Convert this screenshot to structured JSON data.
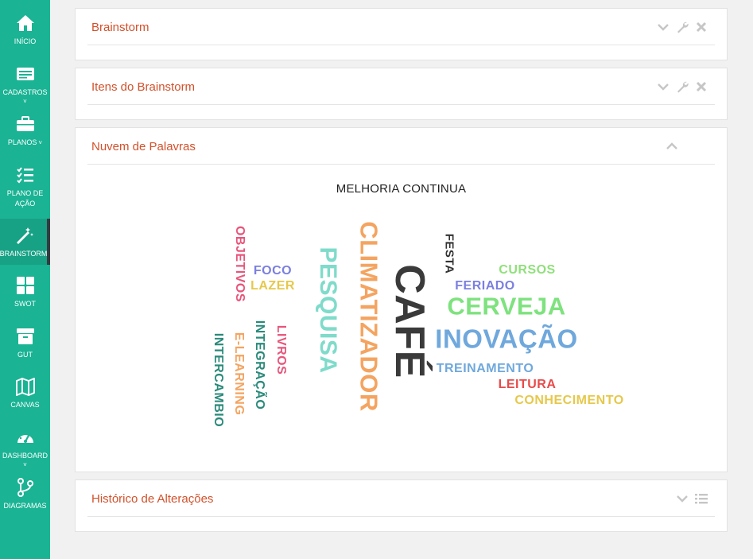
{
  "sidebar": {
    "items": [
      {
        "label": "INÍCIO",
        "icon": "home-icon"
      },
      {
        "label": "CADASTROS",
        "icon": "card-icon"
      },
      {
        "label": "PLANOS",
        "icon": "briefcase-icon"
      },
      {
        "label": "PLANO DE AÇÃO",
        "icon": "checklist-icon"
      },
      {
        "label": "BRAINSTORM",
        "icon": "magic-wand-icon"
      },
      {
        "label": "SWOT",
        "icon": "grid-icon"
      },
      {
        "label": "GUT",
        "icon": "archive-icon"
      },
      {
        "label": "CANVAS",
        "icon": "map-icon"
      },
      {
        "label": "DASHBOARD",
        "icon": "gauge-icon"
      },
      {
        "label": "DIAGRAMAS",
        "icon": "branch-icon"
      }
    ],
    "caret": "˅",
    "active": "BRAINSTORM",
    "color": "#1ab394"
  },
  "panels": {
    "brainstorm": {
      "title": "Brainstorm"
    },
    "itens": {
      "title": "Itens do Brainstorm"
    },
    "nuvem": {
      "title": "Nuvem de Palavras"
    },
    "historico": {
      "title": "Histórico de Alterações"
    }
  },
  "cloud": {
    "title": "MELHORIA CONTINUA",
    "words": [
      {
        "text": "CAFÉ",
        "color": "#3a3a3a",
        "rotated": true
      },
      {
        "text": "CLIMATIZADOR",
        "color": "#f4a460",
        "rotated": true
      },
      {
        "text": "PESQUISA",
        "color": "#7fdbca",
        "rotated": true
      },
      {
        "text": "INOVAÇÃO",
        "color": "#6fa8dc",
        "rotated": false
      },
      {
        "text": "CERVEJA",
        "color": "#7ee27e",
        "rotated": false
      },
      {
        "text": "FERIADO",
        "color": "#7b7fe0",
        "rotated": false
      },
      {
        "text": "CURSOS",
        "color": "#8fe07a",
        "rotated": false
      },
      {
        "text": "FESTA",
        "color": "#333333",
        "rotated": true
      },
      {
        "text": "TREINAMENTO",
        "color": "#6fa8dc",
        "rotated": false
      },
      {
        "text": "LEITURA",
        "color": "#e84a4a",
        "rotated": false
      },
      {
        "text": "CONHECIMENTO",
        "color": "#e6c84a",
        "rotated": false
      },
      {
        "text": "FOCO",
        "color": "#7b7fe0",
        "rotated": false
      },
      {
        "text": "LAZER",
        "color": "#e6c84a",
        "rotated": false
      },
      {
        "text": "OBJETIVOS",
        "color": "#e8557a",
        "rotated": true
      },
      {
        "text": "LIVROS",
        "color": "#e8557a",
        "rotated": true
      },
      {
        "text": "INTEGRAÇÃO",
        "color": "#2a8a7a",
        "rotated": true
      },
      {
        "text": "E-LEARNING",
        "color": "#f4a460",
        "rotated": true
      },
      {
        "text": "INTERCAMBIO",
        "color": "#2a8a7a",
        "rotated": true
      }
    ]
  }
}
